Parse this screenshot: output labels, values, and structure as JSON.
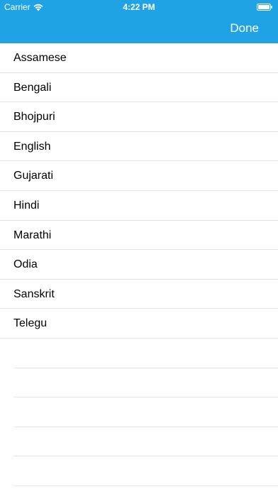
{
  "status_bar": {
    "carrier": "Carrier",
    "time": "4:22 PM"
  },
  "header": {
    "done_label": "Done",
    "background_color": "#1fa3e4"
  },
  "languages": [
    "Assamese",
    "Bengali",
    "Bhojpuri",
    "English",
    "Gujarati",
    "Hindi",
    "Marathi",
    "Odia",
    "Sanskrit",
    "Telegu"
  ],
  "icons": {
    "wifi": "wifi-icon",
    "battery": "battery-icon"
  }
}
